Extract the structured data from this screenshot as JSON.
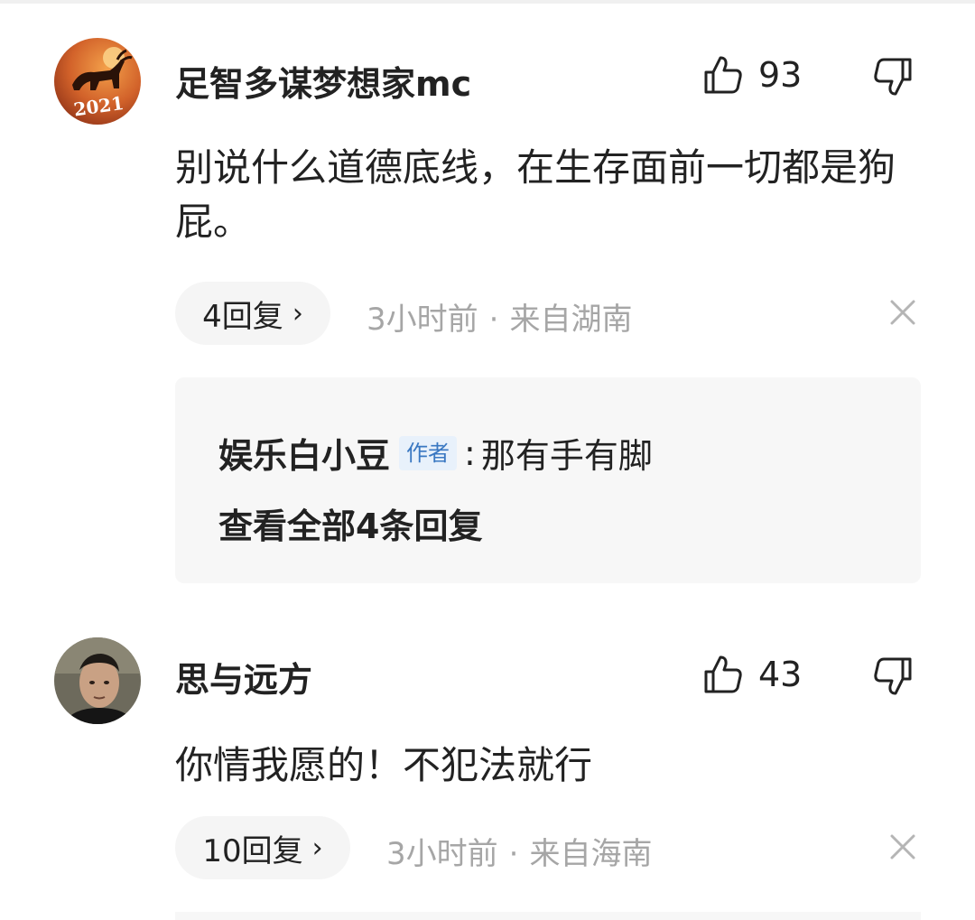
{
  "comments": [
    {
      "username": "足智多谋梦想家mc",
      "like_count": "93",
      "text": "别说什么道德底线，在生存面前一切都是狗屁。",
      "reply_count_label": "4回复",
      "time": "3小时前",
      "location": "来自湖南",
      "avatar_text": "2021",
      "replies": {
        "author": "娱乐白小豆",
        "author_tag": "作者",
        "text": "那有手有脚",
        "view_all": "查看全部4条回复"
      }
    },
    {
      "username": "思与远方",
      "like_count": "43",
      "text": "你情我愿的！不犯法就行",
      "reply_count_label": "10回复",
      "time": "3小时前",
      "location": "来自海南"
    }
  ],
  "icons": {
    "like": "thumbs-up-icon",
    "dislike": "thumbs-down-icon",
    "close": "close-icon",
    "chevron": "chevron-right-icon"
  },
  "colors": {
    "text_primary": "#222222",
    "text_secondary": "#a6a6a6",
    "author_tag_bg": "#e8f1fb",
    "author_tag_text": "#3a78c2"
  }
}
